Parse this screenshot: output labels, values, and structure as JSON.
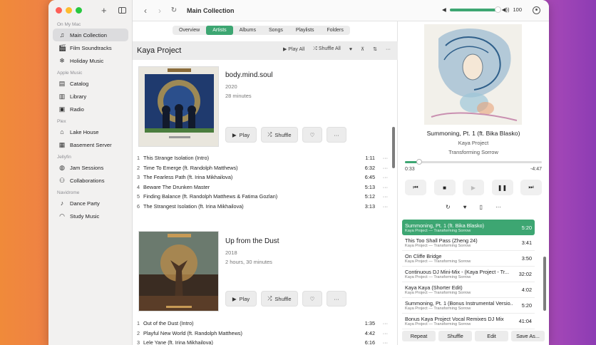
{
  "sidebar": {
    "sections": [
      {
        "header": "On My Mac",
        "items": [
          {
            "label": "Main Collection",
            "icon": "music-note-icon",
            "active": true
          },
          {
            "label": "Film Soundtracks",
            "icon": "clapperboard-icon"
          },
          {
            "label": "Holiday Music",
            "icon": "snowflake-icon"
          }
        ]
      },
      {
        "header": "Apple Music",
        "items": [
          {
            "label": "Catalog",
            "icon": "catalog-icon"
          },
          {
            "label": "Library",
            "icon": "library-icon"
          },
          {
            "label": "Radio",
            "icon": "radio-icon"
          }
        ]
      },
      {
        "header": "Plex",
        "items": [
          {
            "label": "Lake House",
            "icon": "house-icon"
          },
          {
            "label": "Basement Server",
            "icon": "server-icon"
          }
        ]
      },
      {
        "header": "Jellyfin",
        "items": [
          {
            "label": "Jam Sessions",
            "icon": "group-icon"
          },
          {
            "label": "Collaborations",
            "icon": "people-icon"
          }
        ]
      },
      {
        "header": "Navidrome",
        "items": [
          {
            "label": "Dance Party",
            "icon": "dancer-icon"
          },
          {
            "label": "Study Music",
            "icon": "headphones-icon"
          }
        ]
      }
    ]
  },
  "toolbar": {
    "title": "Main Collection",
    "volume": 100,
    "volume_label": "100"
  },
  "tabs": [
    "Overview",
    "Artists",
    "Albums",
    "Songs",
    "Playlists",
    "Folders"
  ],
  "active_tab": "Artists",
  "artist": {
    "name": "Kaya Project",
    "play_all": "Play All",
    "shuffle_all": "Shuffle All"
  },
  "albums": [
    {
      "title": "body.mind.soul",
      "year": "2020",
      "duration": "28 minutes",
      "play": "Play",
      "shuffle": "Shuffle",
      "tracks": [
        {
          "n": "1",
          "name": "This Strange Isolation (Intro)",
          "dur": "1:11"
        },
        {
          "n": "2",
          "name": "Time To Emerge (ft. Randolph Matthews)",
          "dur": "6:32"
        },
        {
          "n": "3",
          "name": "The Fearless Path (ft. Irina Mikhailova)",
          "dur": "6:45"
        },
        {
          "n": "4",
          "name": "Beware The Drunken Master",
          "dur": "5:13"
        },
        {
          "n": "5",
          "name": "Finding Balance (ft. Randolph Matthews & Fatima Gozlan)",
          "dur": "5:12"
        },
        {
          "n": "6",
          "name": "The Strangest Isolation (ft. Irina Mikhailova)",
          "dur": "3:13"
        }
      ]
    },
    {
      "title": "Up from the Dust",
      "year": "2018",
      "duration": "2 hours, 30 minutes",
      "play": "Play",
      "shuffle": "Shuffle",
      "tracks": [
        {
          "n": "1",
          "name": "Out of the Dust (Intro)",
          "dur": "1:35"
        },
        {
          "n": "2",
          "name": "Playful New World (ft. Randolph Matthews)",
          "dur": "4:42"
        },
        {
          "n": "3",
          "name": "Lele Yane (ft. Irina Mikhailova)",
          "dur": "6:16"
        }
      ]
    }
  ],
  "now_playing": {
    "title": "Summoning, Pt. 1 (ft. Bika Blasko)",
    "artist": "Kaya Project",
    "album": "Transforming Sorrow",
    "elapsed": "0:33",
    "remaining": "-4:47",
    "progress": 0.105
  },
  "queue": [
    {
      "title": "Summoning, Pt. 1 (ft. Bika Blasko)",
      "sub": "Kaya Project — Transforming Sorrow",
      "dur": "5:20",
      "active": true
    },
    {
      "title": "This Too Shall Pass (Zheng 24)",
      "sub": "Kaya Project — Transforming Sorrow",
      "dur": "3:41"
    },
    {
      "title": "On Cliffe Bridge",
      "sub": "Kaya Project — Transforming Sorrow",
      "dur": "3:50"
    },
    {
      "title": "Continuous DJ Mini-Mix - (Kaya Project - Tr...",
      "sub": "Kaya Project — Transforming Sorrow",
      "dur": "32:02"
    },
    {
      "title": "Kaya Kaya (Shorter Edit)",
      "sub": "Kaya Project — Transforming Sorrow",
      "dur": "4:02"
    },
    {
      "title": "Summoning, Pt. 1 (Bonus Instrumental Versio...",
      "sub": "Kaya Project — Transforming Sorrow",
      "dur": "5:20"
    },
    {
      "title": "Bonus Kaya Project Vocal Remixes DJ Mix",
      "sub": "Kaya Project — Transforming Sorrow",
      "dur": "41:04"
    }
  ],
  "queue_buttons": [
    "Repeat",
    "Shuffle",
    "Edit",
    "Save As..."
  ],
  "colors": {
    "accent": "#3da672"
  }
}
